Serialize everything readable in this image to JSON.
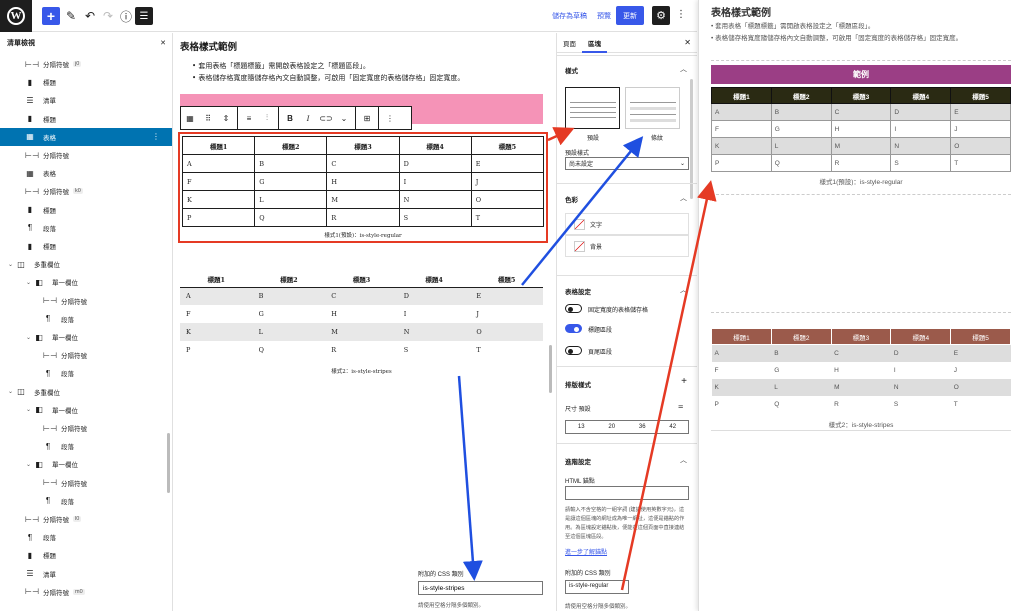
{
  "toolbar": {
    "save_draft": "儲存為草稿",
    "preview": "預覽",
    "publish": "更新"
  },
  "listview": {
    "title": "清單檢視",
    "items": [
      {
        "label": "分隔符號",
        "badge": "j0"
      },
      {
        "label": "標題"
      },
      {
        "label": "清單"
      },
      {
        "label": "標題"
      },
      {
        "label": "表格"
      },
      {
        "label": "分隔符號"
      },
      {
        "label": "表格"
      },
      {
        "label": "分隔符號",
        "badge": "k0"
      },
      {
        "label": "標題"
      },
      {
        "label": "段落"
      },
      {
        "label": "標題"
      },
      {
        "label": "多重欄位"
      },
      {
        "label": "單一欄位"
      },
      {
        "label": "分隔符號"
      },
      {
        "label": "段落"
      },
      {
        "label": "單一欄位"
      },
      {
        "label": "分隔符號"
      },
      {
        "label": "段落"
      },
      {
        "label": "多重欄位"
      },
      {
        "label": "單一欄位"
      },
      {
        "label": "分隔符號"
      },
      {
        "label": "段落"
      },
      {
        "label": "單一欄位"
      },
      {
        "label": "分隔符號"
      },
      {
        "label": "段落"
      },
      {
        "label": "分隔符號",
        "badge": "l0"
      },
      {
        "label": "段落"
      },
      {
        "label": "標題"
      },
      {
        "label": "清單"
      },
      {
        "label": "分隔符號",
        "badge": "m0"
      }
    ]
  },
  "editor": {
    "title": "表格樣式範例",
    "bullets": [
      "• 套用表格「標題標籤」需開啟表格設定之「標題區段」。",
      "• 表格儲存格寬度隨儲存格內文自動調整，可啟用「固定寬度的表格儲存格」固定寬度。"
    ],
    "headers": [
      "標題1",
      "標題2",
      "標題3",
      "標題4",
      "標題5"
    ],
    "rows": [
      [
        "A",
        "B",
        "C",
        "D",
        "E"
      ],
      [
        "F",
        "G",
        "H",
        "I",
        "J"
      ],
      [
        "K",
        "L",
        "M",
        "N",
        "O"
      ],
      [
        "P",
        "Q",
        "R",
        "S",
        "T"
      ]
    ],
    "caption1": "樣式1(預設)：is-style-regular",
    "caption2": "樣式2：is-style-stripes",
    "additional_css_label": "附加的 CSS 類別",
    "additional_css_value": "is-style-stripes",
    "additional_css_help": "請使用空格分隔多個類別。"
  },
  "sidebar": {
    "tab_page": "頁面",
    "tab_block": "區塊",
    "styles_title": "樣式",
    "style_default": "預設",
    "style_stripes": "條紋",
    "default_style_label": "預設樣式",
    "default_style_value": "尚未設定",
    "color_title": "色彩",
    "color_text": "文字",
    "color_bg": "背景",
    "table_settings_title": "表格設定",
    "fixed_width_label": "固定寬度的表格儲存格",
    "header_section_label": "標題區段",
    "footer_section_label": "頁尾區段",
    "typography_title": "排版樣式",
    "size_label": "尺寸 預設",
    "sizes": [
      "13",
      "20",
      "36",
      "42"
    ],
    "advanced_title": "進階設定",
    "html_anchor_label": "HTML 錨點",
    "html_anchor_help": "請輸入不含空格的一組字詞 (建議使用英數字元)，這是讓這個區塊的網址成為唯一網址，這便是錨點的作用。為區塊設定錨點後，便能在這個頁面中直接連結至這個區塊區段。",
    "learn_more": "進一步了解錨點",
    "additional_css_label": "附加的 CSS 類別",
    "additional_css_value": "is-style-regular",
    "additional_css_help": "請使用空格分隔多個類別。",
    "toggles": {
      "fixed_width": false,
      "header_section": true,
      "footer_section": false
    }
  },
  "preview_pane": {
    "title": "表格樣式範例",
    "bullets": [
      "套用表格「標題標籤」需開啟表格設定之「標題區段」。",
      "表格儲存格寬度隨儲存格內文自動調整，可啟用「固定寬度的表格儲存格」固定寬度。"
    ],
    "banner": "範例",
    "caption1": "樣式1(預設)：is-style-regular",
    "caption2": "樣式2：is-style-stripes"
  },
  "colors": {
    "accent": "#3858e9",
    "annotation_red": "#e53a24",
    "annotation_blue": "#1f4fe0",
    "banner": "#9b3e85",
    "table1_header": "#2a2a13",
    "table2_header": "#9b5a4b",
    "pink_bar": "#f593b7"
  }
}
